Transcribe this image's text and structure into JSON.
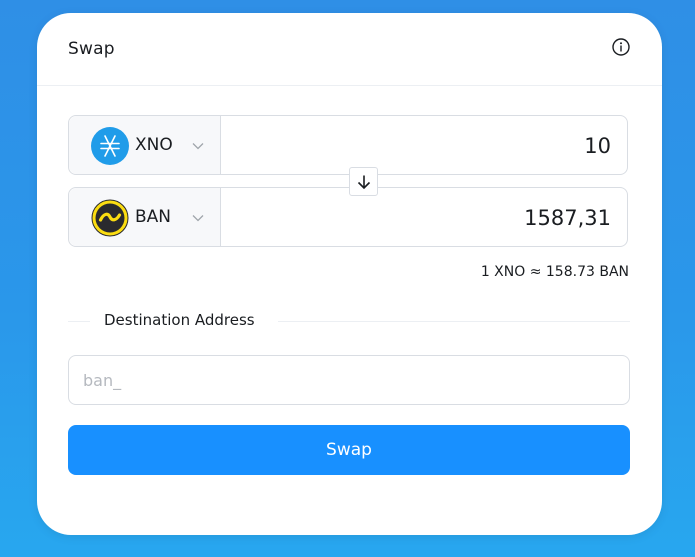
{
  "header": {
    "title": "Swap",
    "info_icon": "info-circle-icon"
  },
  "from": {
    "symbol": "XNO",
    "logo_icon": "nano-logo-icon",
    "logo_color": "#209ce9",
    "amount": "10"
  },
  "to": {
    "symbol": "BAN",
    "logo_icon": "banano-logo-icon",
    "logo_color": "#fbdd11",
    "amount": "1587,31"
  },
  "rate": "1 XNO ≈ 158.73 BAN",
  "destination": {
    "label": "Destination Address",
    "placeholder": "ban_"
  },
  "swap_button": {
    "label": "Swap",
    "color": "#1890ff"
  }
}
